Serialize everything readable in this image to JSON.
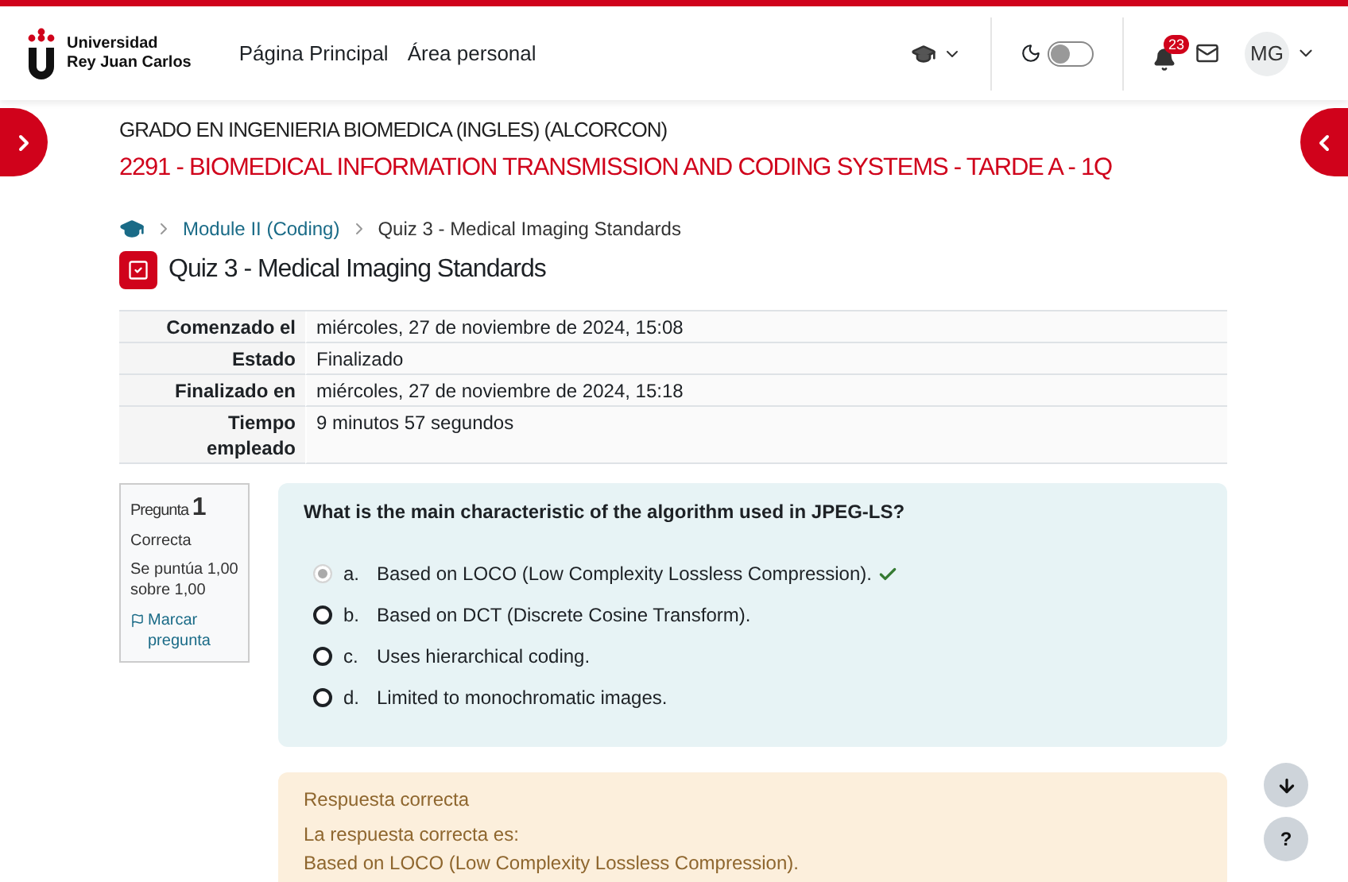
{
  "header": {
    "logo": {
      "line1": "Universidad",
      "line2": "Rey Juan Carlos"
    },
    "nav": [
      {
        "label": "Página Principal",
        "selected": false
      },
      {
        "label": "Área personal",
        "selected": false
      }
    ],
    "dark_mode": {
      "on": false
    },
    "notifications": {
      "count": "23"
    },
    "user": {
      "initials": "MG"
    }
  },
  "course": {
    "category": "GRADO EN INGENIERIA BIOMEDICA (INGLES) (ALCORCON)",
    "title": "2291 - BIOMEDICAL INFORMATION TRANSMISSION AND CODING SYSTEMS - TARDE A - 1Q"
  },
  "breadcrumb": [
    {
      "label": "Module II (Coding)",
      "kind": "link"
    },
    {
      "label": "Quiz 3 - Medical Imaging Standards",
      "kind": "current"
    }
  ],
  "page_title": "Quiz 3 - Medical Imaging Standards",
  "summary": [
    {
      "label": "Comenzado el",
      "value": "miércoles, 27 de noviembre de 2024, 15:08"
    },
    {
      "label": "Estado",
      "value": "Finalizado"
    },
    {
      "label": "Finalizado en",
      "value": "miércoles, 27 de noviembre de 2024, 15:18"
    },
    {
      "label": "Tiempo empleado",
      "value": "9 minutos 57 segundos"
    }
  ],
  "question": {
    "word": "Pregunta",
    "number": "1",
    "status": "Correcta",
    "score": "Se puntúa 1,00 sobre 1,00",
    "flag": "Marcar pregunta",
    "text": "What is the main characteristic of the algorithm used in JPEG-LS?",
    "options": [
      {
        "letter": "a.",
        "text": "Based on LOCO (Low Complexity Lossless Compression).",
        "selected": true,
        "correct": true
      },
      {
        "letter": "b.",
        "text": "Based on DCT (Discrete Cosine Transform).",
        "selected": false,
        "correct": false
      },
      {
        "letter": "c.",
        "text": "Uses hierarchical coding.",
        "selected": false,
        "correct": false
      },
      {
        "letter": "d.",
        "text": "Limited to monochromatic images.",
        "selected": false,
        "correct": false
      }
    ]
  },
  "help_button": {
    "label": "?"
  },
  "feedback": {
    "title": "Respuesta correcta",
    "intro": "La respuesta correcta es:",
    "answer": "Based on LOCO (Low Complexity Lossless Compression)."
  }
}
